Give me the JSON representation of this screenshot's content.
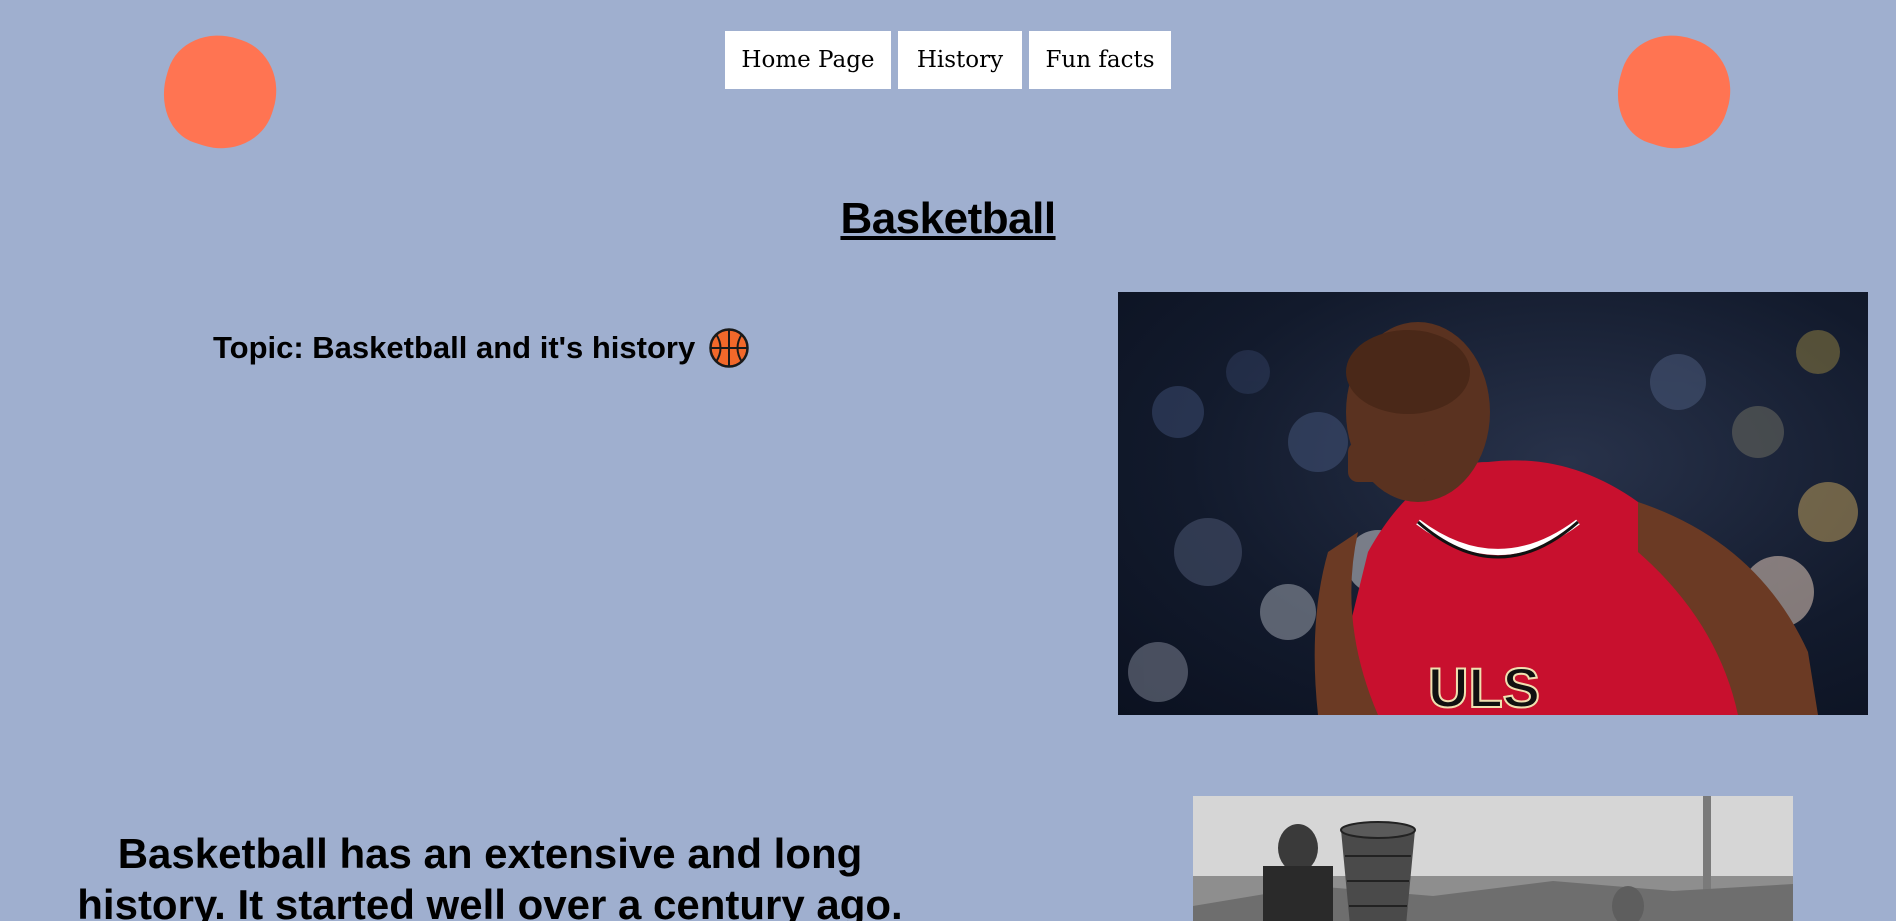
{
  "nav": {
    "items": [
      {
        "label": "Home Page"
      },
      {
        "label": "History"
      },
      {
        "label": "Fun facts"
      }
    ]
  },
  "page": {
    "title": "Basketball",
    "topic": "Topic: Basketball and it's history",
    "history_text": "Basketball has an extensive and long history. It started well over a century ago."
  },
  "images": {
    "player_photo": "basketball-player-photo",
    "history_photo": "early-basketball-peach-basket-photo"
  },
  "colors": {
    "background": "#9fafcf",
    "accent_blob": "#ff7452",
    "nav_button_bg": "#ffffff",
    "ball_orange": "#f2682a"
  },
  "icons": {
    "topic_icon": "basketball-icon"
  }
}
